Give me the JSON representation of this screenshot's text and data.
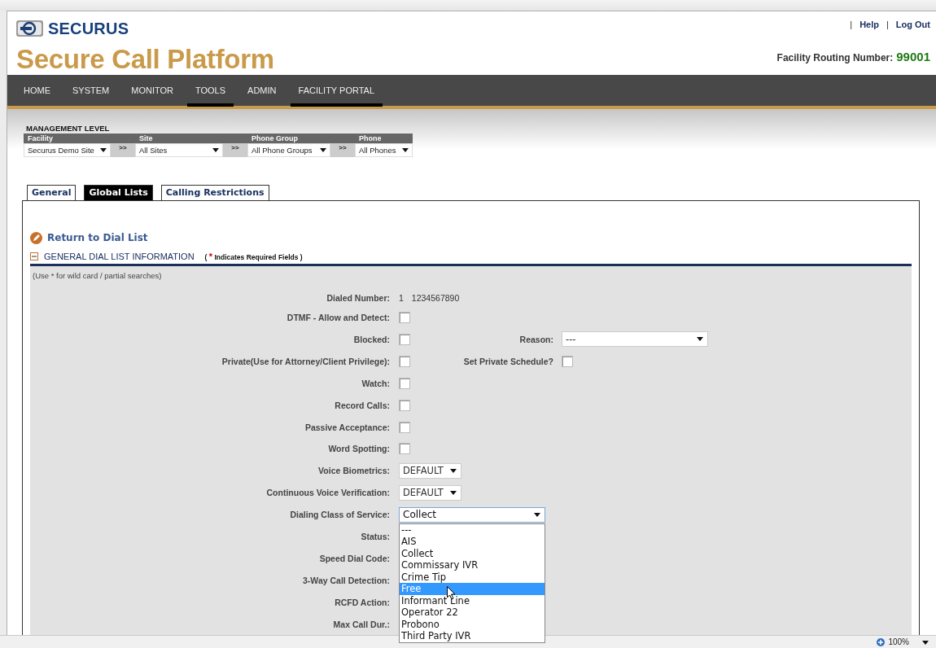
{
  "header": {
    "brand": "SECURUS",
    "title": "Secure Call Platform",
    "links": [
      {
        "kind": "separator",
        "label": "|"
      },
      {
        "kind": "link",
        "label": "Help"
      },
      {
        "kind": "separator",
        "label": "|"
      },
      {
        "kind": "link",
        "label": "Log Out"
      }
    ],
    "routing": {
      "label": "Facility Routing Number:",
      "value": "99001"
    }
  },
  "nav": [
    {
      "label": "HOME",
      "selected": false
    },
    {
      "label": "SYSTEM",
      "selected": false
    },
    {
      "label": "MONITOR",
      "selected": false
    },
    {
      "label": "TOOLS",
      "selected": true
    },
    {
      "label": "ADMIN",
      "selected": false
    },
    {
      "label": "FACILITY PORTAL",
      "selected": true
    }
  ],
  "management": {
    "title": "MANAGEMENT LEVEL",
    "levels": [
      {
        "heading": "Facility",
        "value": "Securus Demo Site",
        "next": ">>"
      },
      {
        "heading": "Site",
        "value": "All Sites",
        "next": ">>"
      },
      {
        "heading": "Phone Group",
        "value": "All Phone Groups",
        "next": ">>"
      },
      {
        "heading": "Phone",
        "value": "All Phones"
      }
    ]
  },
  "tabs": [
    {
      "label": "General",
      "selected": false
    },
    {
      "label": "Global Lists",
      "selected": true
    },
    {
      "label": "Calling Restrictions",
      "selected": false
    }
  ],
  "return_link": "Return to Dial List",
  "section": {
    "title": "GENERAL DIAL LIST INFORMATION",
    "expanded": true,
    "note": {
      "open": "(",
      "mark": "*",
      "text": "Indicates Required Fields )"
    }
  },
  "hint": "(Use * for wild card / partial searches)",
  "fields": [
    {
      "kind": "text",
      "label": "Dialed Number:",
      "values": [
        "1",
        "1234567890"
      ]
    },
    {
      "kind": "checkbox",
      "label": "DTMF - Allow and Detect:",
      "checked": false
    },
    {
      "kind": "checkbox",
      "label": "Blocked:",
      "checked": false,
      "extra": {
        "kind": "select",
        "label": "Reason:",
        "value": "---"
      }
    },
    {
      "kind": "checkbox",
      "label": "Private(Use for Attorney/Client Privilege):",
      "checked": false,
      "extra": {
        "kind": "checkbox",
        "label": "Set Private Schedule?",
        "checked": false
      }
    },
    {
      "kind": "checkbox",
      "label": "Watch:",
      "checked": false
    },
    {
      "kind": "checkbox",
      "label": "Record Calls:",
      "checked": false
    },
    {
      "kind": "checkbox",
      "label": "Passive Acceptance:",
      "checked": false
    },
    {
      "kind": "checkbox",
      "label": "Word Spotting:",
      "checked": false
    },
    {
      "kind": "select",
      "label": "Voice Biometrics:",
      "value": "DEFAULT"
    },
    {
      "kind": "select",
      "label": "Continuous Voice Verification:",
      "value": "DEFAULT"
    },
    {
      "kind": "select",
      "label": "Dialing Class of Service:",
      "value": "Collect",
      "expanded": true,
      "options": [
        {
          "label": "---",
          "highlighted": false
        },
        {
          "label": "AIS",
          "highlighted": false
        },
        {
          "label": "Collect",
          "highlighted": false
        },
        {
          "label": "Commissary IVR",
          "highlighted": false
        },
        {
          "label": "Crime Tip",
          "highlighted": false
        },
        {
          "label": "Free",
          "highlighted": true
        },
        {
          "label": "Informant Line",
          "highlighted": false
        },
        {
          "label": "Operator 22",
          "highlighted": false
        },
        {
          "label": "Probono",
          "highlighted": false
        },
        {
          "label": "Third Party IVR",
          "highlighted": false
        }
      ]
    },
    {
      "kind": "label",
      "label": "Status:"
    },
    {
      "kind": "label",
      "label": "Speed Dial Code:"
    },
    {
      "kind": "label",
      "label": "3-Way Call Detection:"
    },
    {
      "kind": "label",
      "label": "RCFD Action:"
    },
    {
      "kind": "label",
      "label": "Max Call Dur.:"
    }
  ],
  "status_bar": {
    "zoom": "100%"
  }
}
